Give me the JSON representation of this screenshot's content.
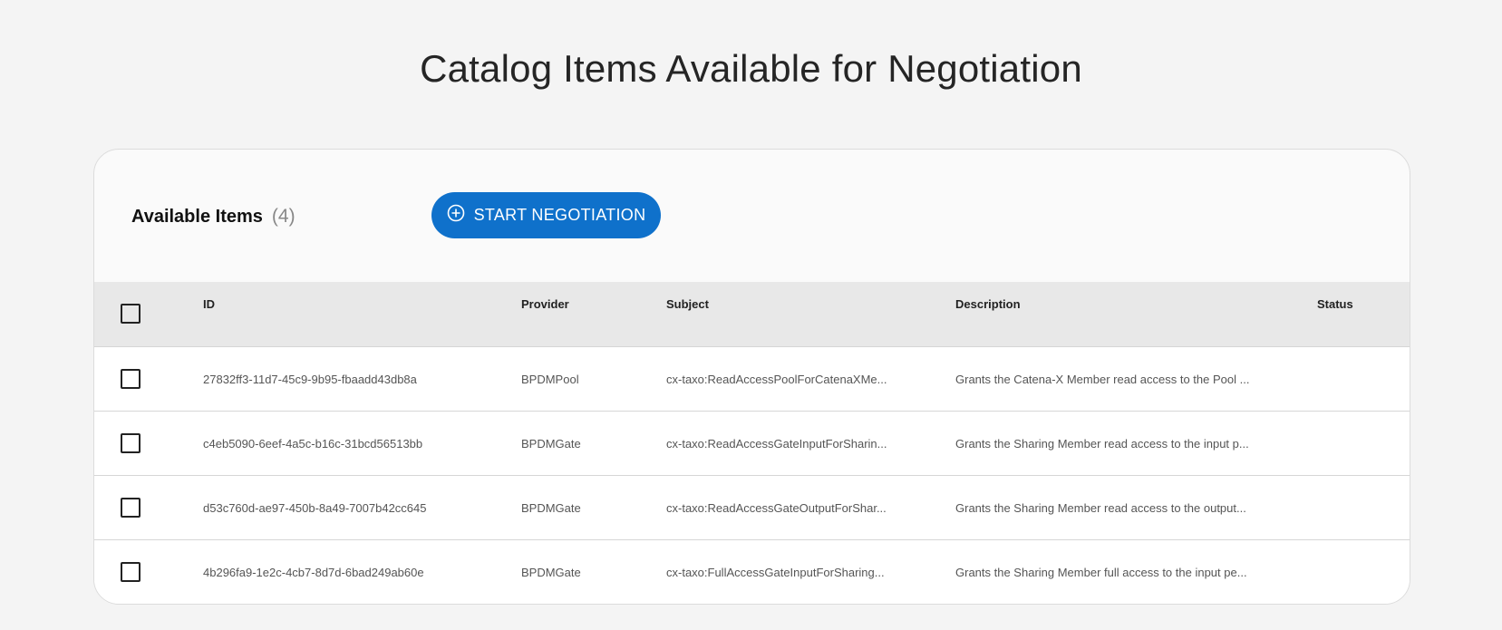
{
  "page": {
    "title": "Catalog Items Available for Negotiation"
  },
  "toolbar": {
    "heading": "Available Items",
    "count": "(4)",
    "start_button_label": "START NEGOTIATION",
    "start_button_icon": "add-circle-icon",
    "accent_color": "#0f71cb"
  },
  "table": {
    "columns": {
      "id": "ID",
      "provider": "Provider",
      "subject": "Subject",
      "description": "Description",
      "status": "Status"
    },
    "rows": [
      {
        "id": "27832ff3-11d7-45c9-9b95-fbaadd43db8a",
        "provider": "BPDMPool",
        "subject": "cx-taxo:ReadAccessPoolForCatenaXMe...",
        "description": "Grants the Catena-X Member read access to the Pool ...",
        "status": ""
      },
      {
        "id": "c4eb5090-6eef-4a5c-b16c-31bcd56513bb",
        "provider": "BPDMGate",
        "subject": "cx-taxo:ReadAccessGateInputForSharin...",
        "description": "Grants the Sharing Member read access to the input p...",
        "status": ""
      },
      {
        "id": "d53c760d-ae97-450b-8a49-7007b42cc645",
        "provider": "BPDMGate",
        "subject": "cx-taxo:ReadAccessGateOutputForShar...",
        "description": "Grants the Sharing Member read access to the output...",
        "status": ""
      },
      {
        "id": "4b296fa9-1e2c-4cb7-8d7d-6bad249ab60e",
        "provider": "BPDMGate",
        "subject": "cx-taxo:FullAccessGateInputForSharing...",
        "description": "Grants the Sharing Member full access to the input pe...",
        "status": ""
      }
    ]
  }
}
